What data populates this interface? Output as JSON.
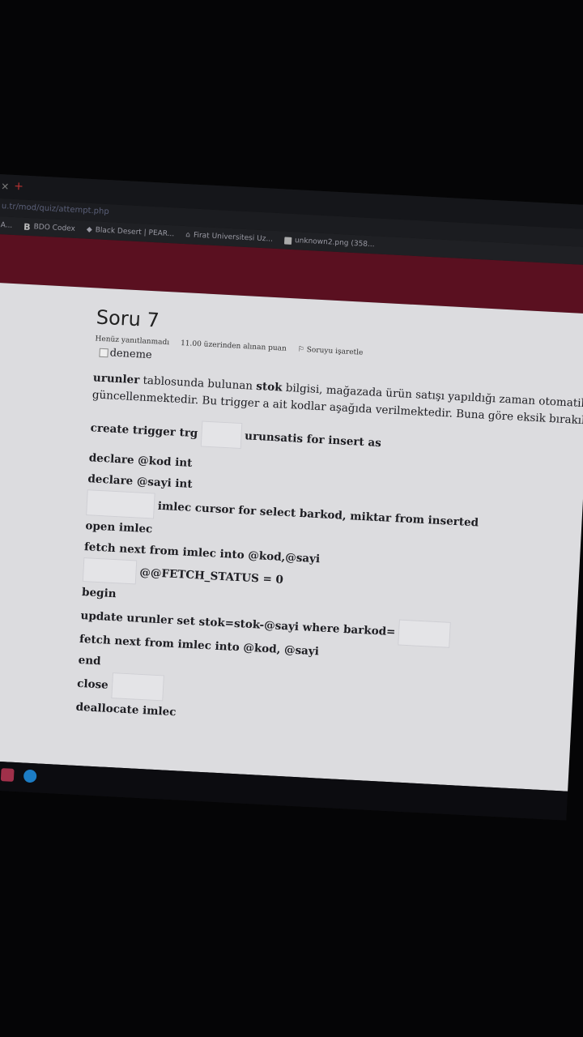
{
  "browser": {
    "url": "u.tr/mod/quiz/attempt.php",
    "bookmarks": [
      {
        "icon": "apps-icon",
        "label": "A..."
      },
      {
        "icon": "bdo-icon",
        "label": "BDO Codex"
      },
      {
        "icon": "bdo-diamond-icon",
        "label": "Black Desert | PEAR..."
      },
      {
        "icon": "university-icon",
        "label": "Firat Universitesi Uz..."
      },
      {
        "icon": "image-file-icon",
        "label": "unknown2.png (358..."
      }
    ]
  },
  "question": {
    "title": "Soru 7",
    "status": "Henüz yanıtlanmadı",
    "points": "11.00 üzerinden alınan puan",
    "flag_label": "Soruyu işaretle",
    "image_alt": "deneme",
    "para_line1_bold1": "urunler",
    "para_line1_text1": " tablosunda bulunan ",
    "para_line1_bold2": "stok",
    "para_line1_text2": " bilgisi, mağazada ürün satışı yapıldığı zaman otomatik o",
    "para_line2": "güncellenmektedir. Bu trigger a ait kodlar aşağıda verilmektedir. Buna göre eksik bırakılan y"
  },
  "code": {
    "line1_a": "create trigger trg",
    "line1_b": "urunsatis for insert as",
    "line2": "declare @kod int",
    "line3": "declare @sayi int",
    "line4": "imlec cursor for select barkod, miktar from inserted",
    "line5": "open imlec",
    "line6": "fetch next from imlec into @kod,@sayi",
    "line7": "@@FETCH_STATUS = 0",
    "line8": "begin",
    "line9": "update urunler set stok=stok-@sayi where barkod=",
    "line10": "fetch next from imlec into @kod, @sayi",
    "line11": "end",
    "line12": "close",
    "line13": "deallocate imlec"
  },
  "colors": {
    "banner": "#5a1020",
    "page_bg": "#dcdcdf"
  }
}
